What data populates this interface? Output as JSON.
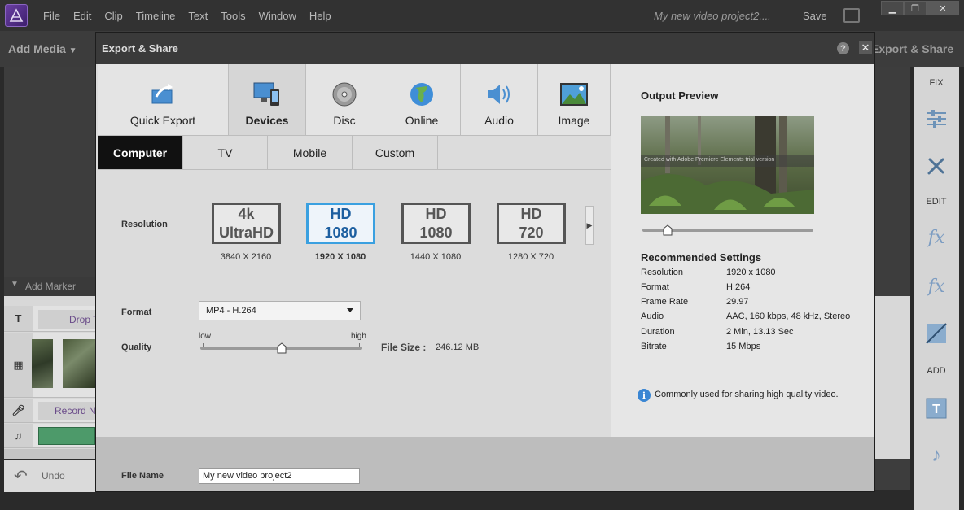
{
  "menubar": {
    "items": [
      "File",
      "Edit",
      "Clip",
      "Timeline",
      "Text",
      "Tools",
      "Window",
      "Help"
    ],
    "project_title": "My new video project2....",
    "save_label": "Save"
  },
  "header": {
    "add_media": "Add Media",
    "export_share": "Export & Share"
  },
  "timeline": {
    "add_marker": "Add Marker",
    "title_track_text": "Drop T",
    "narration_track_text": "Record N",
    "undo_label": "Undo"
  },
  "toolbar": {
    "fix_label": "FIX",
    "edit_label": "EDIT",
    "add_label": "ADD"
  },
  "dialog": {
    "title": "Export & Share",
    "help": "?",
    "close": "✕",
    "export_tabs": [
      {
        "label": "Quick Export",
        "icon": "quick-export-icon"
      },
      {
        "label": "Devices",
        "icon": "devices-icon"
      },
      {
        "label": "Disc",
        "icon": "disc-icon"
      },
      {
        "label": "Online",
        "icon": "globe-icon"
      },
      {
        "label": "Audio",
        "icon": "speaker-icon"
      },
      {
        "label": "Image",
        "icon": "image-icon"
      }
    ],
    "active_export_tab": "Devices",
    "sub_tabs": [
      "Computer",
      "TV",
      "Mobile",
      "Custom"
    ],
    "active_sub_tab": "Computer",
    "resolution_label": "Resolution",
    "resolutions": [
      {
        "line1": "4k",
        "line2": "UltraHD",
        "caption": "3840 X 2160"
      },
      {
        "line1": "HD",
        "line2": "1080",
        "caption": "1920 X 1080"
      },
      {
        "line1": "HD",
        "line2": "1080",
        "caption": "1440 X 1080"
      },
      {
        "line1": "HD",
        "line2": "720",
        "caption": "1280 X 720"
      }
    ],
    "selected_resolution_index": 1,
    "format_label": "Format",
    "format_value": "MP4 - H.264",
    "quality_label": "Quality",
    "quality_low": "low",
    "quality_high": "high",
    "quality_level": 0.5,
    "file_size_label": "File Size :",
    "file_size_value": "246.12 MB",
    "file_name_label": "File Name",
    "file_name_value": "My new video project2"
  },
  "preview": {
    "title": "Output Preview",
    "watermark": "Created with Adobe Premiere Elements trial version",
    "scrub_position": 0.15,
    "recommended_title": "Recommended Settings",
    "settings": [
      {
        "label": "Resolution",
        "value": "1920 x 1080"
      },
      {
        "label": "Format",
        "value": "H.264"
      },
      {
        "label": "Frame Rate",
        "value": "29.97"
      },
      {
        "label": "Audio",
        "value": "AAC, 160 kbps, 48 kHz, Stereo"
      },
      {
        "label": "Duration",
        "value": "2 Min, 13.13 Sec"
      },
      {
        "label": "Bitrate",
        "value": "15 Mbps"
      }
    ],
    "info_text": "Commonly used for sharing high quality video."
  },
  "colors": {
    "accent_blue": "#3aa0e0",
    "selected_text": "#1d5fa0"
  }
}
